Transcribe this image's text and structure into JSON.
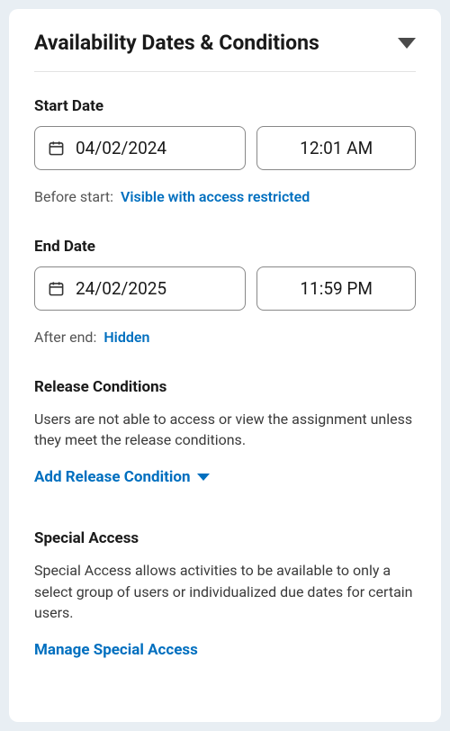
{
  "header": {
    "title": "Availability Dates & Conditions"
  },
  "startDate": {
    "label": "Start Date",
    "date": "04/02/2024",
    "time": "12:01 AM",
    "beforePrefix": "Before start:",
    "beforeValue": "Visible with access restricted"
  },
  "endDate": {
    "label": "End Date",
    "date": "24/02/2025",
    "time": "11:59 PM",
    "afterPrefix": "After end:",
    "afterValue": "Hidden"
  },
  "releaseConditions": {
    "heading": "Release Conditions",
    "description": "Users are not able to access or view the assignment unless they meet the release conditions.",
    "action": "Add Release Condition"
  },
  "specialAccess": {
    "heading": "Special Access",
    "description": "Special Access allows activities to be available to only a select group of users or individualized due dates for certain users.",
    "action": "Manage Special Access"
  },
  "colors": {
    "link": "#006fbf"
  }
}
